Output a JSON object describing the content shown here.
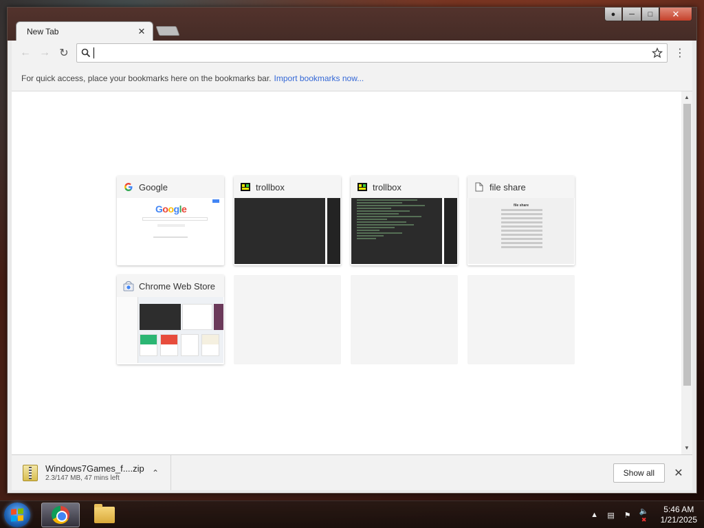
{
  "browser": {
    "tab_title": "New Tab",
    "omnibox": {
      "value": "",
      "placeholder": ""
    },
    "bookmarks_bar": {
      "message": "For quick access, place your bookmarks here on the bookmarks bar.",
      "import_link": "Import bookmarks now..."
    }
  },
  "tiles": [
    {
      "title": "Google",
      "icon": "google-icon"
    },
    {
      "title": "trollbox",
      "icon": "trollbox-icon"
    },
    {
      "title": "trollbox",
      "icon": "trollbox-icon"
    },
    {
      "title": "file share",
      "icon": "document-icon"
    },
    {
      "title": "Chrome Web Store",
      "icon": "web-store-icon"
    }
  ],
  "thumbnails": {
    "google_logo": "Google",
    "file_share_heading": "file share"
  },
  "download": {
    "filename": "Windows7Games_f....zip",
    "status": "2.3/147 MB, 47 mins left",
    "show_all": "Show all"
  },
  "taskbar": {
    "time": "5:46 AM",
    "date": "1/21/2025"
  },
  "colors": {
    "link": "#3367d6",
    "close_button": "#c5402a"
  }
}
